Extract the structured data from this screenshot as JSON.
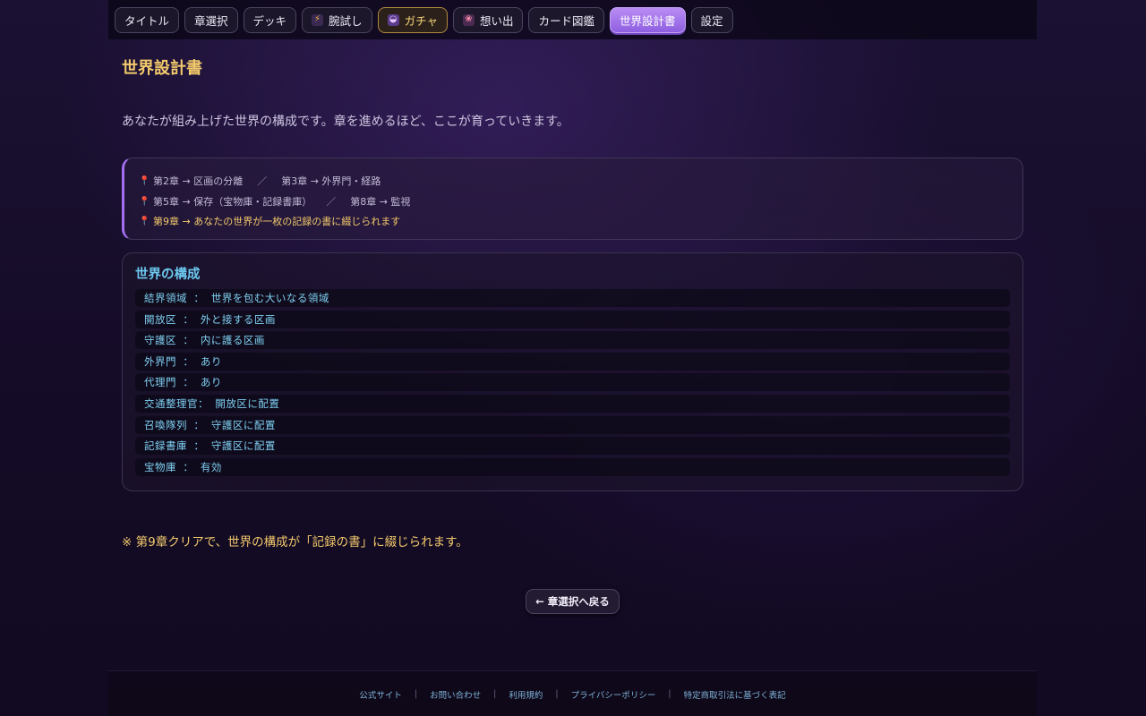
{
  "nav": {
    "items": [
      {
        "label": "タイトル"
      },
      {
        "label": "章選択"
      },
      {
        "label": "デッキ"
      },
      {
        "label": "腕試し",
        "icon": "lightning-icon"
      },
      {
        "label": "ガチャ",
        "icon": "gacha-icon"
      },
      {
        "label": "想い出",
        "icon": "memory-icon"
      },
      {
        "label": "カード図鑑"
      },
      {
        "label": "世界設計書"
      },
      {
        "label": "設定"
      }
    ],
    "active": "世界設計書"
  },
  "page": {
    "title": "世界設計書",
    "lead": "あなたが組み上げた世界の構成です。章を進めるほど、ここが育っていきます。"
  },
  "progress": {
    "line1": {
      "a": "第2章 → 区画の分離",
      "sep": "／",
      "b": "第3章 → 外界門・経路"
    },
    "line2": {
      "a": "第5章 → 保存（宝物庫・記録書庫）",
      "sep": "／",
      "b": "第8章 → 監視"
    },
    "line3": {
      "a": "第9章 → あなたの世界が一枚の記録の書に綴じられます"
    }
  },
  "config": {
    "title": "世界の構成",
    "rows": [
      "結界領域 ： 世界を包む大いなる領域",
      "開放区 ： 外と接する区画",
      "守護区 ： 内に護る区画",
      "外界門 ： あり",
      "代理門 ： あり",
      "交通整理官： 開放区に配置",
      "召喚隊列 ： 守護区に配置",
      "記録書庫 ： 守護区に配置",
      "宝物庫 ： 有効"
    ]
  },
  "note": "※ 第9章クリアで、世界の構成が「記録の書」に綴じられます。",
  "back_button": "← 章選択へ戻る",
  "footer": {
    "links": [
      "公式サイト",
      "お問い合わせ",
      "利用規約",
      "プライバシーポリシー",
      "特定商取引法に基づく表記"
    ],
    "separator": "|"
  },
  "colors": {
    "accent_gold": "#f2c96b",
    "accent_cyan": "#6cc7ee",
    "active_tab": "#a46ff0"
  }
}
